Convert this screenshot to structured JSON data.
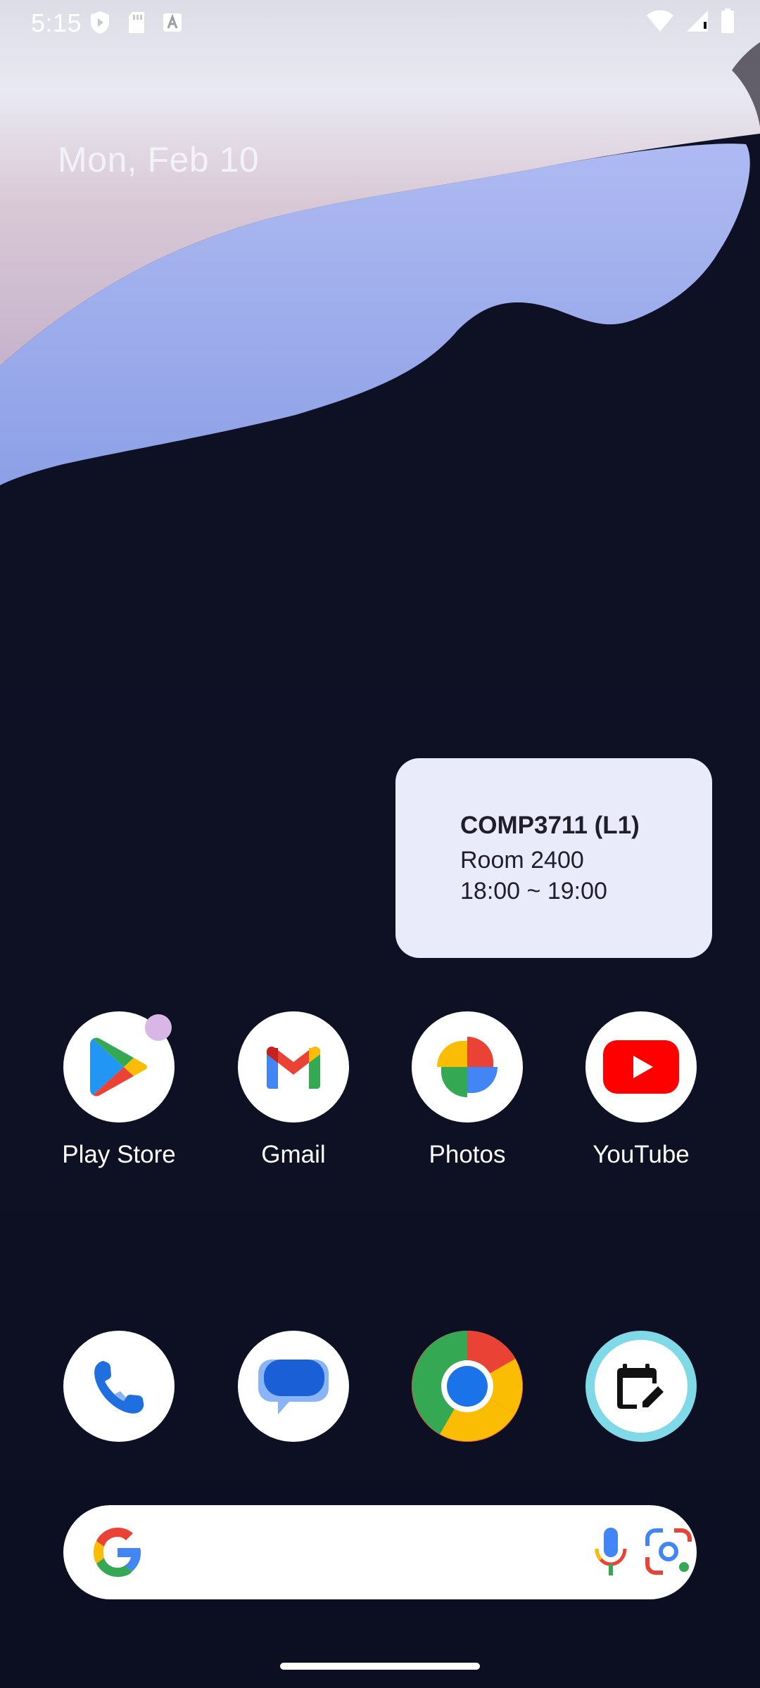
{
  "status_bar": {
    "time": "5:15",
    "left_icons": [
      "shield-play-icon",
      "sd-card-icon",
      "keyboard-a-icon"
    ],
    "right_icons": [
      "wifi-icon",
      "signal-icon",
      "battery-icon"
    ]
  },
  "date": "Mon, Feb 10",
  "widget": {
    "title": "COMP3711 (L1)",
    "room": "Room 2400",
    "time": "18:00 ~ 19:00"
  },
  "apps_row1": [
    {
      "label": "Play Store",
      "icon": "play-store-icon",
      "has_badge": true
    },
    {
      "label": "Gmail",
      "icon": "gmail-icon"
    },
    {
      "label": "Photos",
      "icon": "photos-icon"
    },
    {
      "label": "YouTube",
      "icon": "youtube-icon"
    }
  ],
  "dock": [
    {
      "icon": "phone-icon"
    },
    {
      "icon": "messages-icon"
    },
    {
      "icon": "chrome-icon"
    },
    {
      "icon": "calendar-edit-icon"
    }
  ],
  "search_bar": {
    "icons": [
      "google-g-icon",
      "mic-icon",
      "lens-icon"
    ]
  },
  "colors": {
    "background": "#0e1024",
    "widget_bg": "#e9ebfb",
    "wallpaper_blue": "#9fb1ee"
  }
}
